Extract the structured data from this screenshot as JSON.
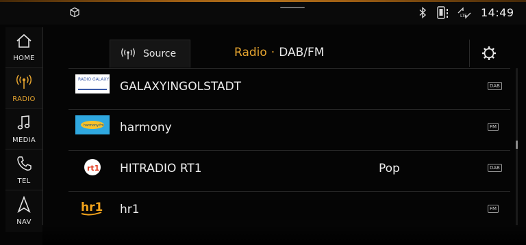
{
  "status_bar": {
    "time": "14:49",
    "icons": [
      "cube-icon",
      "bluetooth-icon",
      "phone-battery-icon",
      "lte-signal-icon"
    ],
    "accent_color": "#c57c1d"
  },
  "nav": {
    "items": [
      {
        "label": "HOME",
        "icon": "home-icon",
        "active": false
      },
      {
        "label": "RADIO",
        "icon": "radio-antenna-icon",
        "active": true
      },
      {
        "label": "MEDIA",
        "icon": "music-note-icon",
        "active": false
      },
      {
        "label": "TEL",
        "icon": "phone-icon",
        "active": false
      },
      {
        "label": "NAV",
        "icon": "navigation-arrow-icon",
        "active": false
      }
    ],
    "active_color": "#e7a52f"
  },
  "header": {
    "source_label": "Source",
    "title_primary": "Radio",
    "title_separator": "·",
    "title_secondary": "DAB/FM",
    "settings_icon": "gear-icon"
  },
  "stations": [
    {
      "name": "GALAXYINGOLSTADT",
      "genre": "",
      "band": "DAB",
      "logo_text": "RADIO GALAXY"
    },
    {
      "name": "harmony",
      "genre": "",
      "band": "FM",
      "logo_text": "harmony.fm"
    },
    {
      "name": "HITRADIO RT1",
      "genre": "Pop",
      "band": "DAB",
      "logo_text": "rt1"
    },
    {
      "name": "hr1",
      "genre": "",
      "band": "FM",
      "logo_text": "hr1"
    }
  ]
}
